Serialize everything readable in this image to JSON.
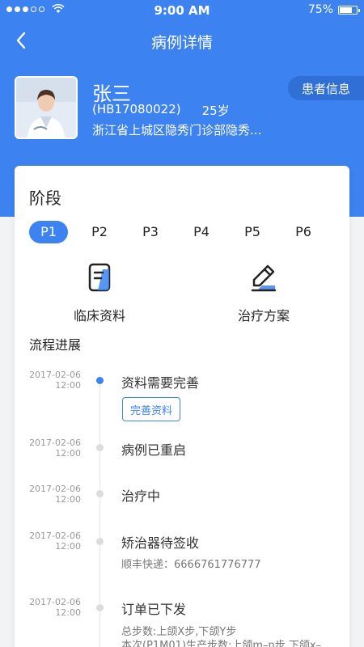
{
  "status_bar": {
    "time": "9:00 AM",
    "battery": "75%",
    "battery_level": 0.75
  },
  "nav": {
    "title": "病例详情"
  },
  "patient": {
    "name": "张三",
    "id": "(HB17080022)",
    "age": "25岁",
    "address": "浙江省上城区隐秀门诊部隐秀...",
    "info_button": "患者信息"
  },
  "stage": {
    "title": "阶段",
    "phases": [
      "P1",
      "P2",
      "P3",
      "P4",
      "P5",
      "P6"
    ],
    "active_phase": "P1"
  },
  "features": {
    "clinical": "临床资料",
    "treatment": "治疗方案"
  },
  "progress": {
    "title": "流程进展",
    "items": [
      {
        "date": "2017-02-06",
        "time": "12:00",
        "text": "资料需要完善",
        "button": "完善资料"
      },
      {
        "date": "2017-02-06",
        "time": "12:00",
        "text": "病例已重启"
      },
      {
        "date": "2017-02-06",
        "time": "12:00",
        "text": "治疗中"
      },
      {
        "date": "2017-02-06",
        "time": "12:00",
        "text": "矫治器待签收",
        "sub": "顺丰快递：6666761776777"
      },
      {
        "date": "2017-02-06",
        "time": "12:00",
        "text": "订单已下发",
        "sub": "总步数:上颌X步,下颌Y步",
        "sub2": "本次(P1M01)生产步数:上颌m–n步,下颌x–"
      }
    ]
  },
  "colors": {
    "primary": "#3c82f0"
  }
}
